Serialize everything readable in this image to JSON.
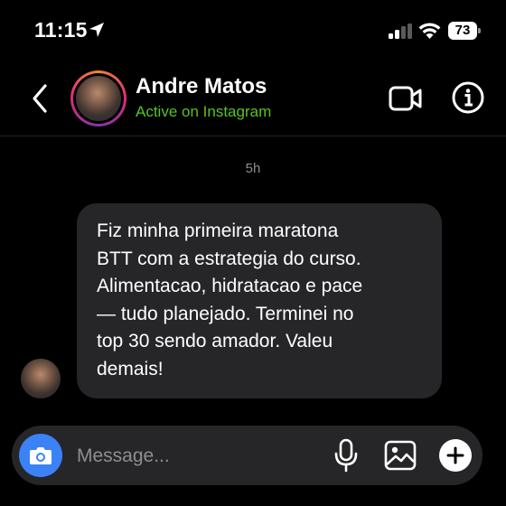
{
  "status_bar": {
    "time": "11:15",
    "battery_percent": "73",
    "location_icon": "location-arrow-icon",
    "signal_icon": "cellular-signal-icon",
    "wifi_icon": "wifi-icon"
  },
  "header": {
    "contact_name": "Andre Matos",
    "contact_status": "Active on Instagram",
    "back_icon": "chevron-left-icon",
    "video_icon": "video-camera-icon",
    "info_icon": "info-icon"
  },
  "conversation": {
    "timestamp": "5h",
    "messages": [
      {
        "lines": [
          "Fiz minha primeira maratona",
          "BTT com a estrategia do curso.",
          "Alimentacao, hidratacao e pace",
          "— tudo planejado. Terminei no",
          "top 30 sendo amador.  Valeu",
          "demais!"
        ]
      }
    ]
  },
  "composer": {
    "placeholder": "Message...",
    "camera_icon": "camera-icon",
    "mic_icon": "microphone-icon",
    "gallery_icon": "image-gallery-icon",
    "plus_icon": "plus-icon"
  },
  "colors": {
    "background": "#000000",
    "bubble": "#262628",
    "active_status": "#58c322",
    "camera_button": "#3b82f6",
    "muted_text": "#8e8e93"
  }
}
